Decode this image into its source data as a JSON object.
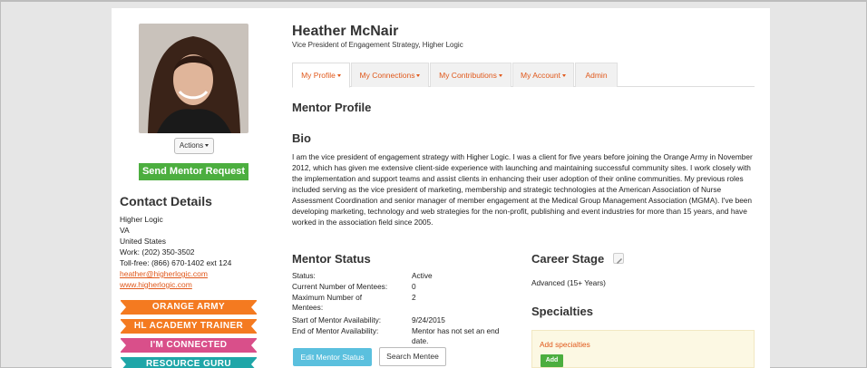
{
  "profile": {
    "name": "Heather McNair",
    "title": "Vice President of Engagement Strategy, Higher Logic",
    "actions_label": "Actions",
    "send_request_label": "Send Mentor Request"
  },
  "contact": {
    "heading": "Contact Details",
    "company": "Higher Logic",
    "state": "VA",
    "country": "United States",
    "work": "Work: (202) 350-3502",
    "tollfree": "Toll-free: (866) 670-1402 ext 124",
    "email": "heather@higherlogic.com",
    "website": "www.higherlogic.com"
  },
  "badges": [
    {
      "label": "ORANGE ARMY",
      "color": "#f47a20"
    },
    {
      "label": "HL ACADEMY TRAINER",
      "color": "#f47a20"
    },
    {
      "label": "I'M CONNECTED",
      "color": "#d94f8a"
    },
    {
      "label": "RESOURCE GURU",
      "color": "#1fa6a8"
    }
  ],
  "tabs": [
    {
      "label": "My Profile",
      "active": true,
      "dropdown": true
    },
    {
      "label": "My Connections",
      "active": false,
      "dropdown": true
    },
    {
      "label": "My Contributions",
      "active": false,
      "dropdown": true
    },
    {
      "label": "My Account",
      "active": false,
      "dropdown": true
    },
    {
      "label": "Admin",
      "active": false,
      "dropdown": false
    }
  ],
  "main": {
    "section_title": "Mentor Profile",
    "bio_heading": "Bio",
    "bio_text": "I am the vice president of engagement strategy with Higher Logic. I was a client for five years before joining the Orange Army in November 2012, which has given me extensive client-side experience with launching and maintaining successful community sites. I work closely with the implementation and support teams and assist clients in enhancing their user adoption of their online communities. My previous roles included serving as the vice president of marketing, membership and strategic technologies at the American Association of Nurse Assessment Coordination and senior manager of member engagement at the Medical Group Management Association (MGMA). I've been developing marketing, technology and web strategies for the non-profit, publishing and event industries for more than 15 years, and have worked in the association field since 2005."
  },
  "mentor_status": {
    "heading": "Mentor Status",
    "rows": [
      {
        "key": "Status:",
        "value": "Active"
      },
      {
        "key": "Current Number of Mentees:",
        "value": "0"
      },
      {
        "key": "Maximum Number of Mentees:",
        "value": "2"
      },
      {
        "key": "Start of Mentor Availability:",
        "value": "9/24/2015"
      },
      {
        "key": "End of Mentor Availability:",
        "value": "Mentor has not set an end date."
      }
    ],
    "edit_label": "Edit Mentor Status",
    "search_label": "Search Mentee"
  },
  "career": {
    "heading": "Career Stage",
    "value": "Advanced (15+ Years)"
  },
  "specialties": {
    "heading": "Specialties",
    "add_prompt": "Add specialties",
    "add_label": "Add"
  },
  "colors": {
    "accent": "#e0581b",
    "green": "#4cae3f",
    "info": "#5bc0de"
  }
}
